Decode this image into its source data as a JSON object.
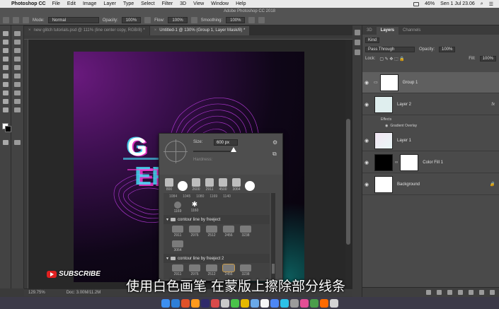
{
  "menubar": {
    "app_name": "Photoshop CC",
    "items": [
      "File",
      "Edit",
      "Image",
      "Layer",
      "Type",
      "Select",
      "Filter",
      "3D",
      "View",
      "Window",
      "Help"
    ],
    "battery": "46%",
    "clock": "Sen 1 Jul 23.06"
  },
  "window_title": "Adobe Photoshop CC 2018",
  "options": {
    "mode_label": "Mode:",
    "mode_value": "Normal",
    "opacity_label": "Opacity:",
    "opacity_value": "100%",
    "flow_label": "Flow:",
    "flow_value": "100%",
    "smoothing_label": "Smoothing:",
    "smoothing_value": "100%"
  },
  "tabs": [
    {
      "label": "new glitch tutorials.psd @ 111% (line center copy, RGB/8) *"
    },
    {
      "label": "Untitled-1 @ 130% (Group 1, Layer Mask/8) *"
    }
  ],
  "brush_picker": {
    "size_label": "Size:",
    "size_value": "600 px",
    "hardness_label": "Hardness:",
    "recent": [
      "800",
      "",
      "2600",
      "2911",
      "4500",
      "3064",
      ""
    ],
    "number_row": [
      "1084",
      "1045",
      "1080",
      "1169",
      "1140"
    ],
    "single_row": [
      "1169",
      "1160"
    ],
    "folders": [
      {
        "name": "contour line by freeject",
        "brushes": [
          "2911",
          "2976",
          "2512",
          "2456",
          "3238"
        ],
        "extra": "3064"
      },
      {
        "name": "contour line by freeject 2",
        "brushes": [
          "2911",
          "2976",
          "2512",
          "2456",
          "3238"
        ],
        "extra": "3064"
      }
    ]
  },
  "status": {
    "zoom": "129.75%",
    "doc": "Doc: 3.00M/11.2M"
  },
  "subtitle": "使用白色画笔 在蒙版上擦除部分线条",
  "subscribe": "SUBSCRIBE",
  "layers_panel": {
    "tabs": [
      "3D",
      "Layers",
      "Channels"
    ],
    "kind_label": "Kind",
    "blend_mode": "Pass Through",
    "opacity_label": "Opacity:",
    "opacity_value": "100%",
    "lock_label": "Lock:",
    "fill_label": "Fill:",
    "fill_value": "100%",
    "layers": [
      {
        "name": "Group 1"
      },
      {
        "name": "Layer 2",
        "fx": "fx"
      },
      {
        "name": "Layer 1"
      },
      {
        "name": "Color Fill 1"
      },
      {
        "name": "Background"
      }
    ],
    "effects_label": "Effects",
    "gradient_overlay_label": "Gradient Overlay"
  },
  "colors": {
    "accent_selected": "#5f5f5f",
    "canvas_magenta": "#6a1a7e",
    "glitch_cyan": "#44e8ff",
    "glitch_pink": "#ff3ad6"
  }
}
